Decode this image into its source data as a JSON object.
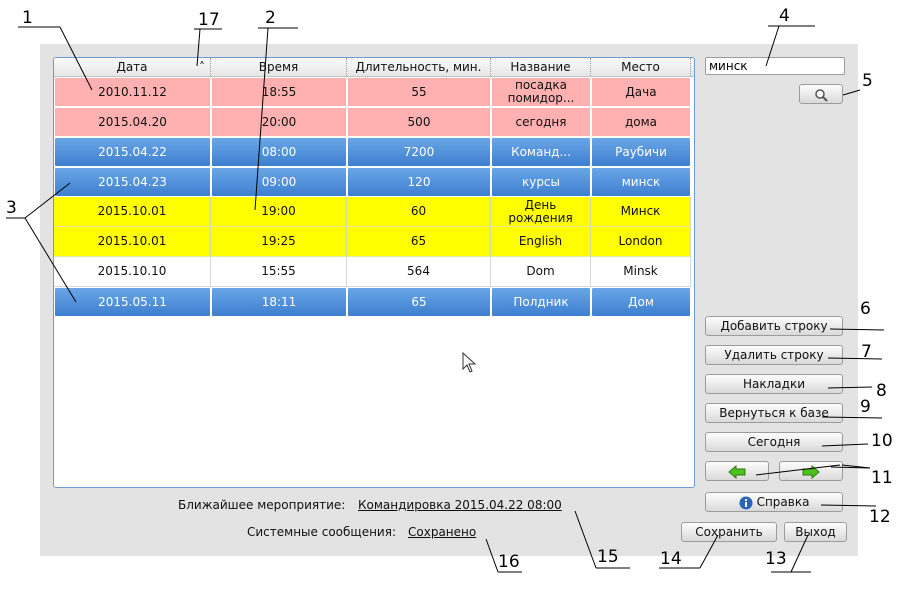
{
  "table": {
    "columns": [
      "Дата",
      "Время",
      "Длительность, мин.",
      "Название",
      "Место"
    ],
    "rows": [
      {
        "style": "pink",
        "cells": [
          "2010.11.12",
          "18:55",
          "55",
          "посадка помидор...",
          "Дача"
        ]
      },
      {
        "style": "pink",
        "cells": [
          "2015.04.20",
          "20:00",
          "500",
          "сегодня",
          "дома"
        ]
      },
      {
        "style": "blue",
        "cells": [
          "2015.04.22",
          "08:00",
          "7200",
          "Команд...",
          "Раубичи"
        ]
      },
      {
        "style": "blue",
        "cells": [
          "2015.04.23",
          "09:00",
          "120",
          "курсы",
          "минск"
        ]
      },
      {
        "style": "yellow",
        "cells": [
          "2015.10.01",
          "19:00",
          "60",
          "День рождения",
          "Минск"
        ]
      },
      {
        "style": "yellow",
        "cells": [
          "2015.10.01",
          "19:25",
          "65",
          "English",
          "London"
        ]
      },
      {
        "style": "white",
        "cells": [
          "2015.10.10",
          "15:55",
          "564",
          "Dom",
          "Minsk"
        ]
      },
      {
        "style": "blue",
        "cells": [
          "2015.05.11",
          "18:11",
          "65",
          "Полдник",
          "Дом"
        ]
      }
    ]
  },
  "search": {
    "value": "минск"
  },
  "buttons": {
    "add_row": "Добавить строку",
    "delete_row": "Удалить строку",
    "bookmarks": "Накладки",
    "back_to_db": "Вернуться к базе",
    "today": "Сегодня",
    "help": "Справка",
    "save": "Сохранить",
    "exit": "Выход"
  },
  "status": {
    "next_event_label": "Ближайшее мероприятие:",
    "next_event_value": "Командировка 2015.04.22 08:00",
    "system_label": "Системные сообщения:",
    "system_value": "Сохранено"
  },
  "annotations": [
    "1",
    "2",
    "3",
    "4",
    "5",
    "6",
    "7",
    "8",
    "9",
    "10",
    "11",
    "12",
    "13",
    "14",
    "15",
    "16",
    "17"
  ],
  "colors": {
    "pink_row": "#ffb0b0",
    "blue_row": "#4a8cdc",
    "yellow_row": "#ffff00",
    "grid_border": "#6f9bd0"
  },
  "icons": {
    "search": "magnifier-icon",
    "left": "green-arrow-left-icon",
    "right": "green-arrow-right-icon",
    "help": "info-icon",
    "sort": "sort-ascending-icon",
    "cursor": "mouse-pointer-icon"
  }
}
